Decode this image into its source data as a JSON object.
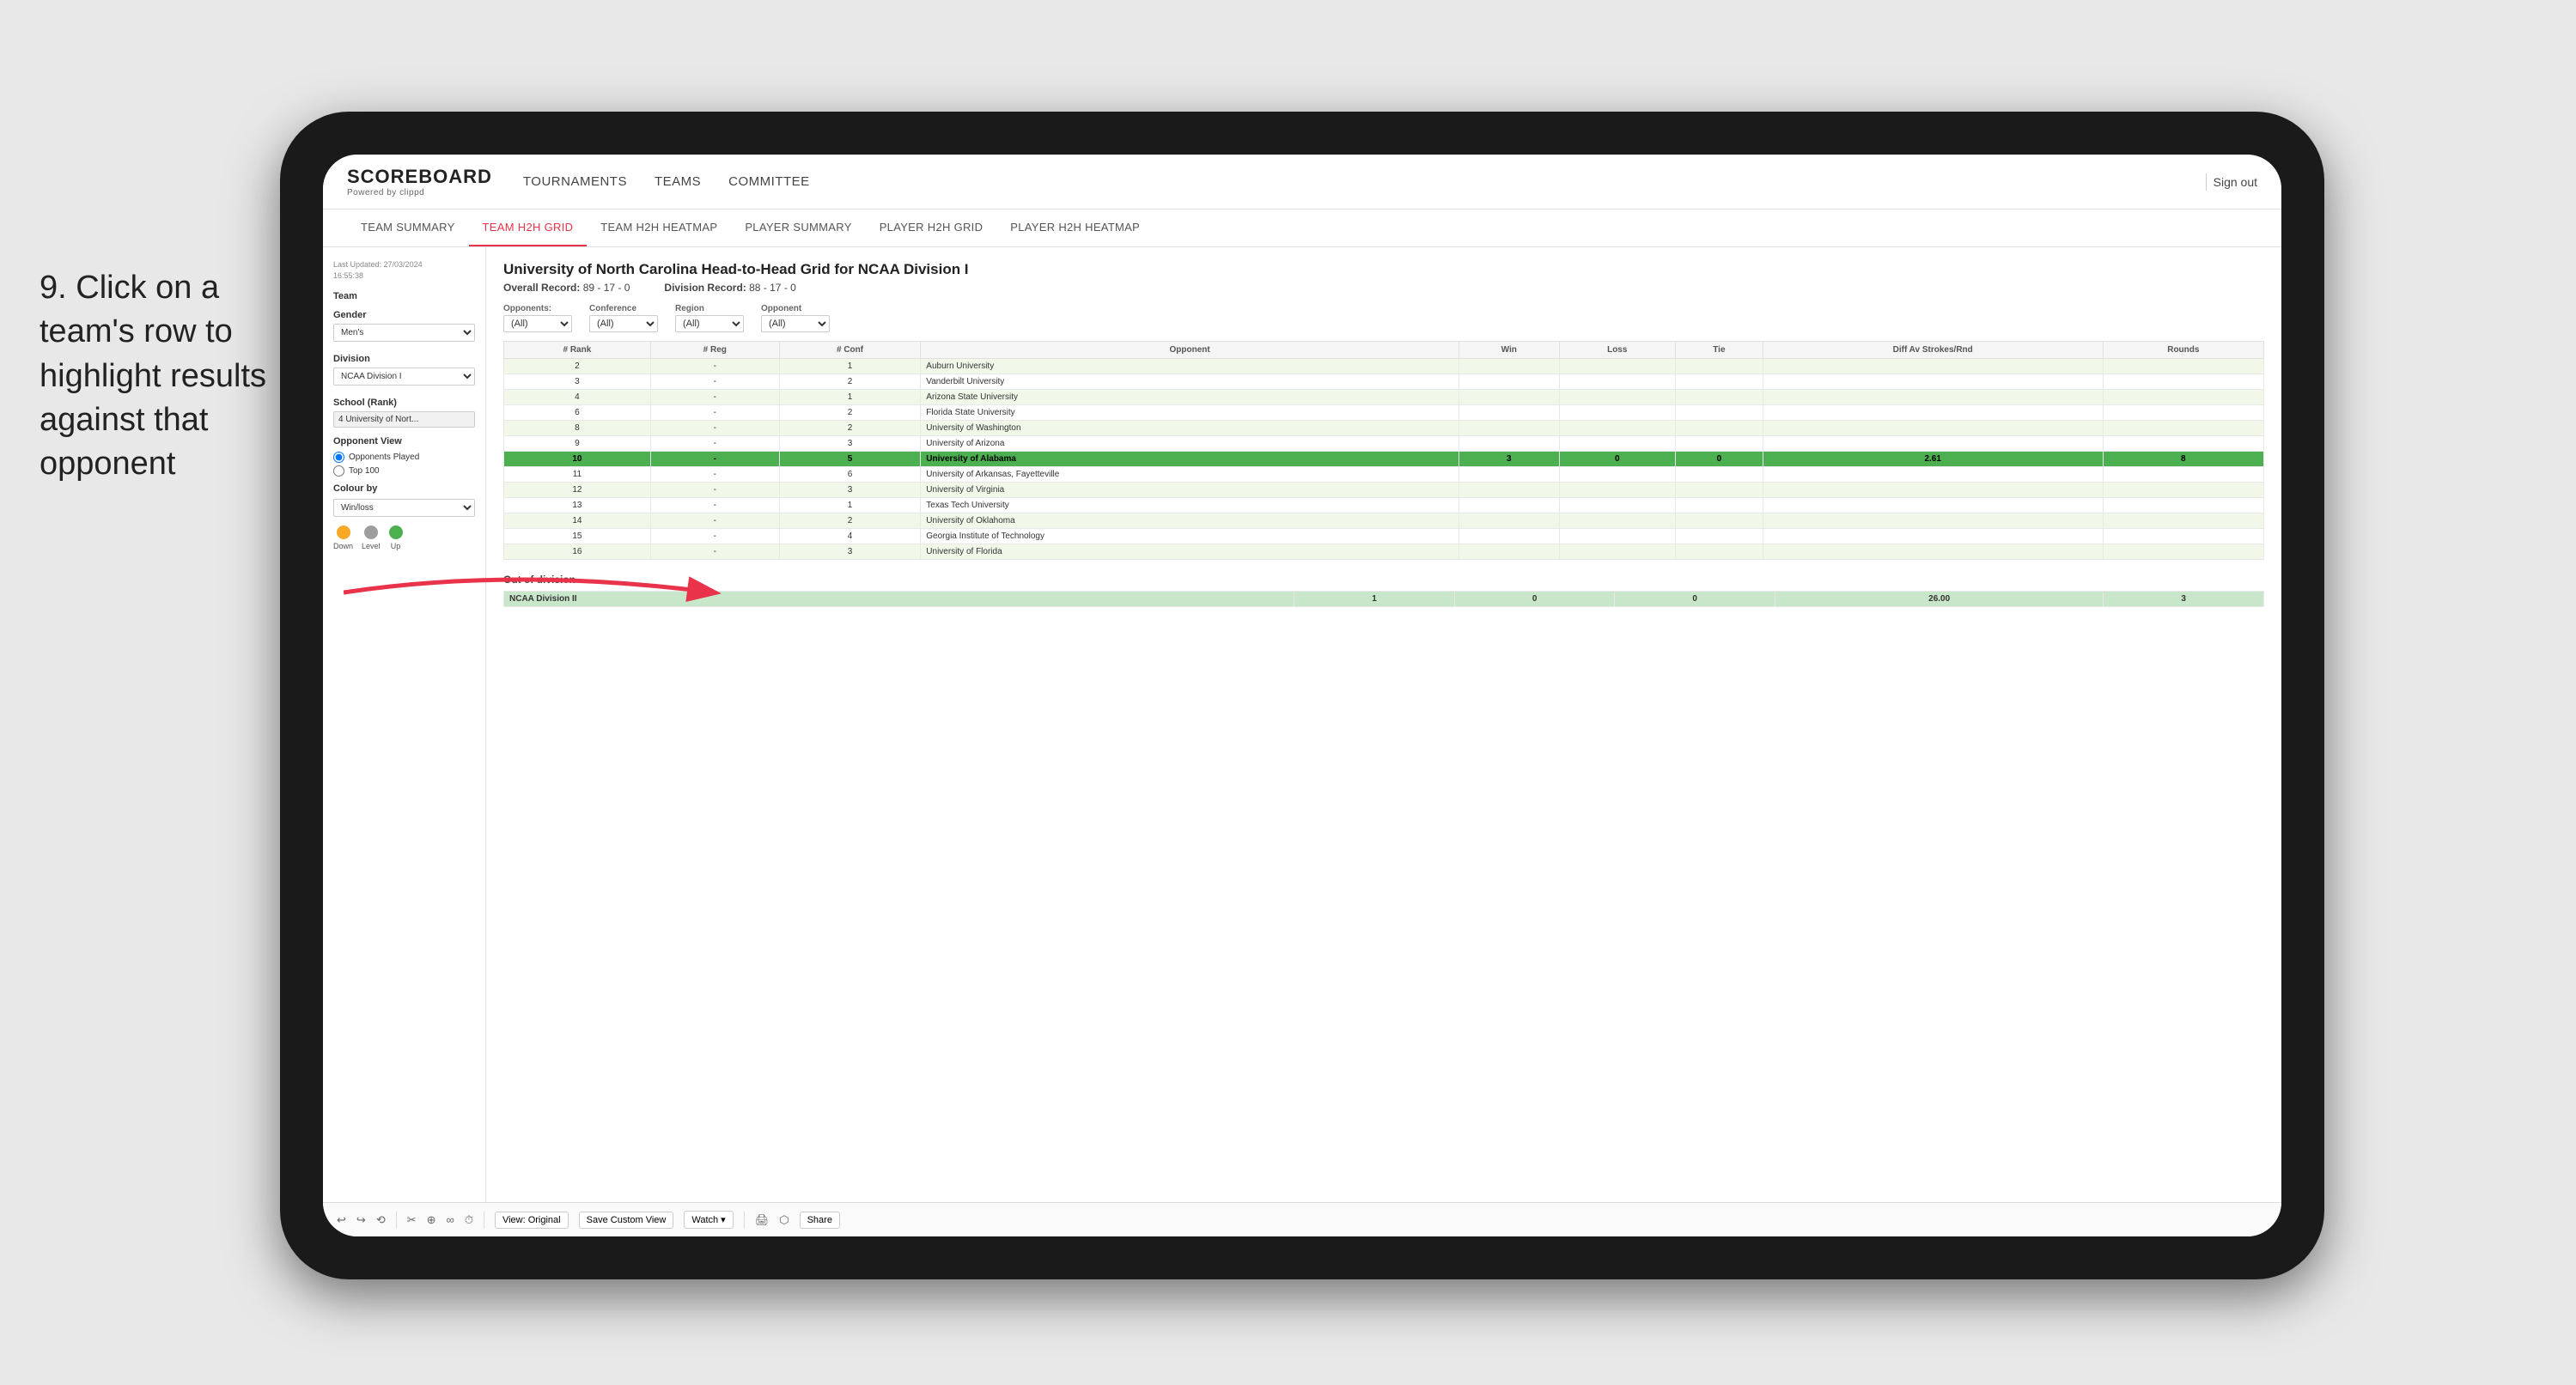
{
  "instruction": {
    "text": "9. Click on a team's row to highlight results against that opponent"
  },
  "tablet": {
    "nav": {
      "logo": "SCOREBOARD",
      "logo_sub": "Powered by clippd",
      "items": [
        "TOURNAMENTS",
        "TEAMS",
        "COMMITTEE"
      ],
      "sign_out": "Sign out"
    },
    "sub_nav": {
      "items": [
        "TEAM SUMMARY",
        "TEAM H2H GRID",
        "TEAM H2H HEATMAP",
        "PLAYER SUMMARY",
        "PLAYER H2H GRID",
        "PLAYER H2H HEATMAP"
      ],
      "active": "TEAM H2H GRID"
    },
    "sidebar": {
      "timestamp_label": "Last Updated: 27/03/2024",
      "timestamp_time": "16:55:38",
      "team_label": "Team",
      "gender_label": "Gender",
      "gender_value": "Men's",
      "division_label": "Division",
      "division_value": "NCAA Division I",
      "school_label": "School (Rank)",
      "school_value": "4 University of Nort...",
      "opponent_view_label": "Opponent View",
      "radio_options": [
        "Opponents Played",
        "Top 100"
      ],
      "radio_selected": "Opponents Played",
      "colour_by_label": "Colour by",
      "colour_by_value": "Win/loss",
      "legend": [
        {
          "label": "Down",
          "color": "#f9a825"
        },
        {
          "label": "Level",
          "color": "#9e9e9e"
        },
        {
          "label": "Up",
          "color": "#4caf50"
        }
      ]
    },
    "grid": {
      "title": "University of North Carolina Head-to-Head Grid for NCAA Division I",
      "overall_record_label": "Overall Record:",
      "overall_record": "89 - 17 - 0",
      "division_record_label": "Division Record:",
      "division_record": "88 - 17 - 0",
      "filters": {
        "opponents_label": "Opponents:",
        "opponents_value": "(All)",
        "conference_label": "Conference",
        "conference_value": "(All)",
        "region_label": "Region",
        "region_value": "(All)",
        "opponent_label": "Opponent",
        "opponent_value": "(All)"
      },
      "columns": [
        "# Rank",
        "# Reg",
        "# Conf",
        "Opponent",
        "Win",
        "Loss",
        "Tie",
        "Diff Av Strokes/Rnd",
        "Rounds"
      ],
      "rows": [
        {
          "rank": "2",
          "reg": "-",
          "conf": "1",
          "opponent": "Auburn University",
          "win": "",
          "loss": "",
          "tie": "",
          "diff": "",
          "rounds": "",
          "style": "light-green"
        },
        {
          "rank": "3",
          "reg": "-",
          "conf": "2",
          "opponent": "Vanderbilt University",
          "win": "",
          "loss": "",
          "tie": "",
          "diff": "",
          "rounds": "",
          "style": "white"
        },
        {
          "rank": "4",
          "reg": "-",
          "conf": "1",
          "opponent": "Arizona State University",
          "win": "",
          "loss": "",
          "tie": "",
          "diff": "",
          "rounds": "",
          "style": "light-green"
        },
        {
          "rank": "6",
          "reg": "-",
          "conf": "2",
          "opponent": "Florida State University",
          "win": "",
          "loss": "",
          "tie": "",
          "diff": "",
          "rounds": "",
          "style": "white"
        },
        {
          "rank": "8",
          "reg": "-",
          "conf": "2",
          "opponent": "University of Washington",
          "win": "",
          "loss": "",
          "tie": "",
          "diff": "",
          "rounds": "",
          "style": "light-green"
        },
        {
          "rank": "9",
          "reg": "-",
          "conf": "3",
          "opponent": "University of Arizona",
          "win": "",
          "loss": "",
          "tie": "",
          "diff": "",
          "rounds": "",
          "style": "white"
        },
        {
          "rank": "10",
          "reg": "-",
          "conf": "5",
          "opponent": "University of Alabama",
          "win": "3",
          "loss": "0",
          "tie": "0",
          "diff": "2.61",
          "rounds": "8",
          "style": "selected"
        },
        {
          "rank": "11",
          "reg": "-",
          "conf": "6",
          "opponent": "University of Arkansas, Fayetteville",
          "win": "",
          "loss": "",
          "tie": "",
          "diff": "",
          "rounds": "",
          "style": "white"
        },
        {
          "rank": "12",
          "reg": "-",
          "conf": "3",
          "opponent": "University of Virginia",
          "win": "",
          "loss": "",
          "tie": "",
          "diff": "",
          "rounds": "",
          "style": "light-green"
        },
        {
          "rank": "13",
          "reg": "-",
          "conf": "1",
          "opponent": "Texas Tech University",
          "win": "",
          "loss": "",
          "tie": "",
          "diff": "",
          "rounds": "",
          "style": "white"
        },
        {
          "rank": "14",
          "reg": "-",
          "conf": "2",
          "opponent": "University of Oklahoma",
          "win": "",
          "loss": "",
          "tie": "",
          "diff": "",
          "rounds": "",
          "style": "light-green"
        },
        {
          "rank": "15",
          "reg": "-",
          "conf": "4",
          "opponent": "Georgia Institute of Technology",
          "win": "",
          "loss": "",
          "tie": "",
          "diff": "",
          "rounds": "",
          "style": "white"
        },
        {
          "rank": "16",
          "reg": "-",
          "conf": "3",
          "opponent": "University of Florida",
          "win": "",
          "loss": "",
          "tie": "",
          "diff": "",
          "rounds": "",
          "style": "light-green"
        }
      ],
      "out_of_division_label": "Out of division",
      "division_summary_row": {
        "label": "NCAA Division II",
        "win": "1",
        "loss": "0",
        "tie": "0",
        "diff": "26.00",
        "rounds": "3"
      }
    },
    "toolbar": {
      "buttons": [
        "↩",
        "↪",
        "⟲",
        "✂",
        "⊕",
        "∞",
        "⏱",
        "View: Original",
        "Save Custom View",
        "Watch ▾",
        "🖨",
        "⬡",
        "Share"
      ]
    }
  }
}
